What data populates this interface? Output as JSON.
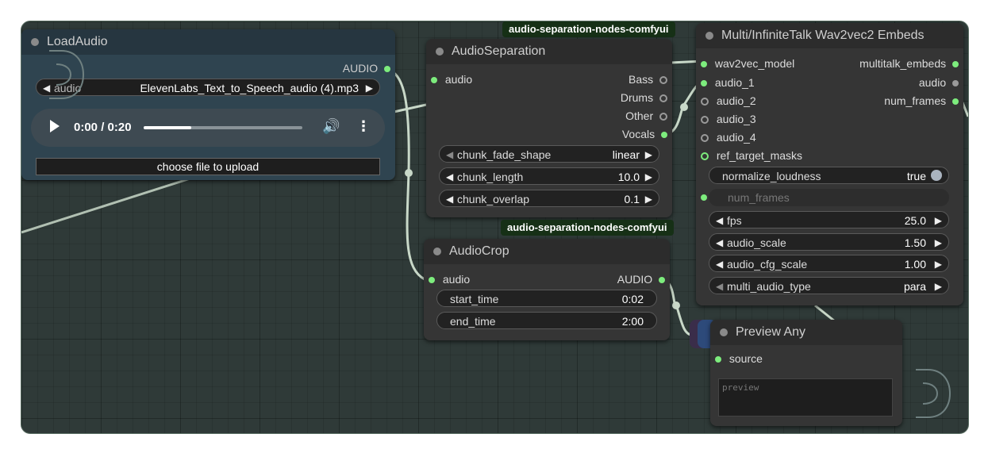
{
  "nodes": {
    "load_audio": {
      "title": "LoadAudio",
      "output_label": "AUDIO",
      "combo_label": "audio",
      "combo_value": "ElevenLabs_Text_to_Speech_audio (4).mp3",
      "player_time": "0:00 / 0:20",
      "player_progress": 0.3,
      "upload_label": "choose file to upload"
    },
    "audio_separation": {
      "badge": "audio-separation-nodes-comfyui",
      "title": "AudioSeparation",
      "input_label": "audio",
      "outputs": [
        "Bass",
        "Drums",
        "Other",
        "Vocals"
      ],
      "widgets": [
        {
          "label": "chunk_fade_shape",
          "value": "linear"
        },
        {
          "label": "chunk_length",
          "value": "10.0"
        },
        {
          "label": "chunk_overlap",
          "value": "0.1"
        }
      ]
    },
    "audio_crop": {
      "badge": "audio-separation-nodes-comfyui",
      "title": "AudioCrop",
      "input_label": "audio",
      "output_label": "AUDIO",
      "widgets": [
        {
          "label": "start_time",
          "value": "0:02"
        },
        {
          "label": "end_time",
          "value": "2:00"
        }
      ]
    },
    "multitalk": {
      "title": "Multi/InfiniteTalk Wav2vec2 Embeds",
      "inputs": [
        "wav2vec_model",
        "audio_1",
        "audio_2",
        "audio_3",
        "audio_4",
        "ref_target_masks"
      ],
      "outputs": [
        "multitalk_embeds",
        "audio",
        "num_frames"
      ],
      "toggle": {
        "label": "normalize_loudness",
        "value": "true"
      },
      "disabled_input": "num_frames",
      "widgets": [
        {
          "label": "fps",
          "value": "25.0"
        },
        {
          "label": "audio_scale",
          "value": "1.50"
        },
        {
          "label": "audio_cfg_scale",
          "value": "1.00"
        },
        {
          "label": "multi_audio_type",
          "value": "para"
        }
      ]
    },
    "preview_any": {
      "title": "Preview Any",
      "input_label": "source",
      "preview_placeholder": "preview"
    }
  },
  "colors": {
    "slot_connected": "#7dec7d",
    "canvas_bg": "#2f3a38",
    "node_bg": "#353535",
    "link": "#c8d8c8",
    "badge_bg": "#163016"
  }
}
